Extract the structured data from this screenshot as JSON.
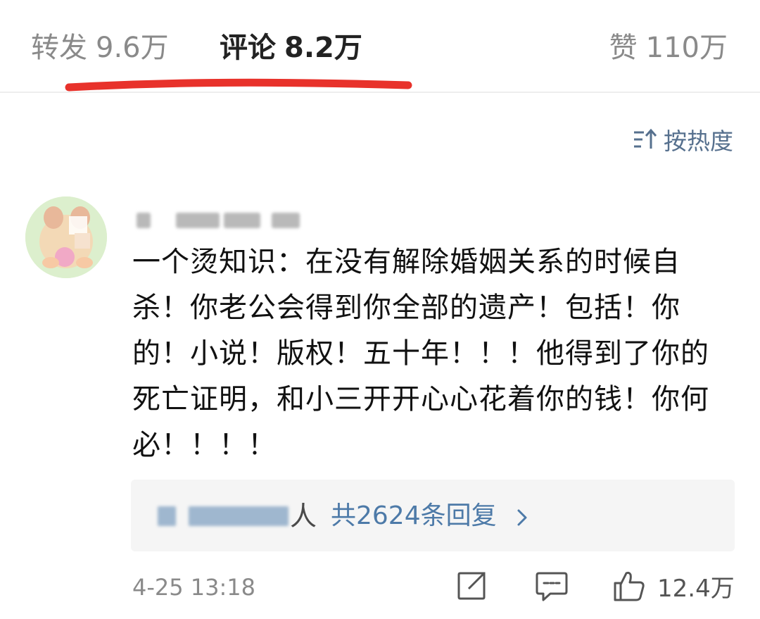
{
  "tabs": {
    "repost": {
      "label": "转发",
      "count": "9.6万"
    },
    "comments": {
      "label": "评论",
      "count": "8.2万"
    },
    "likes": {
      "label": "赞",
      "count": "110万"
    }
  },
  "sort": {
    "label": "按热度",
    "icon": "sort-icon"
  },
  "comment": {
    "text": "一个烫知识：在没有解除婚姻关系的时候自杀！你老公会得到你全部的遗产！包括！你的！小说！版权！五十年！！！他得到了你的死亡证明，和小三开开心心花着你的钱！你何必！！！！",
    "replies": {
      "person_suffix": "人",
      "count_text": "共2624条回复"
    },
    "time": "4-25 13:18",
    "like_count": "12.4万"
  },
  "colors": {
    "accent_link": "#4d7aa8",
    "sort_text": "#56708e",
    "annotation_red": "#e8322b",
    "muted_text": "#8a8a8a"
  },
  "icons": [
    "sort-icon",
    "chevron-right-icon",
    "share-icon",
    "reply-icon",
    "thumbs-up-icon"
  ]
}
